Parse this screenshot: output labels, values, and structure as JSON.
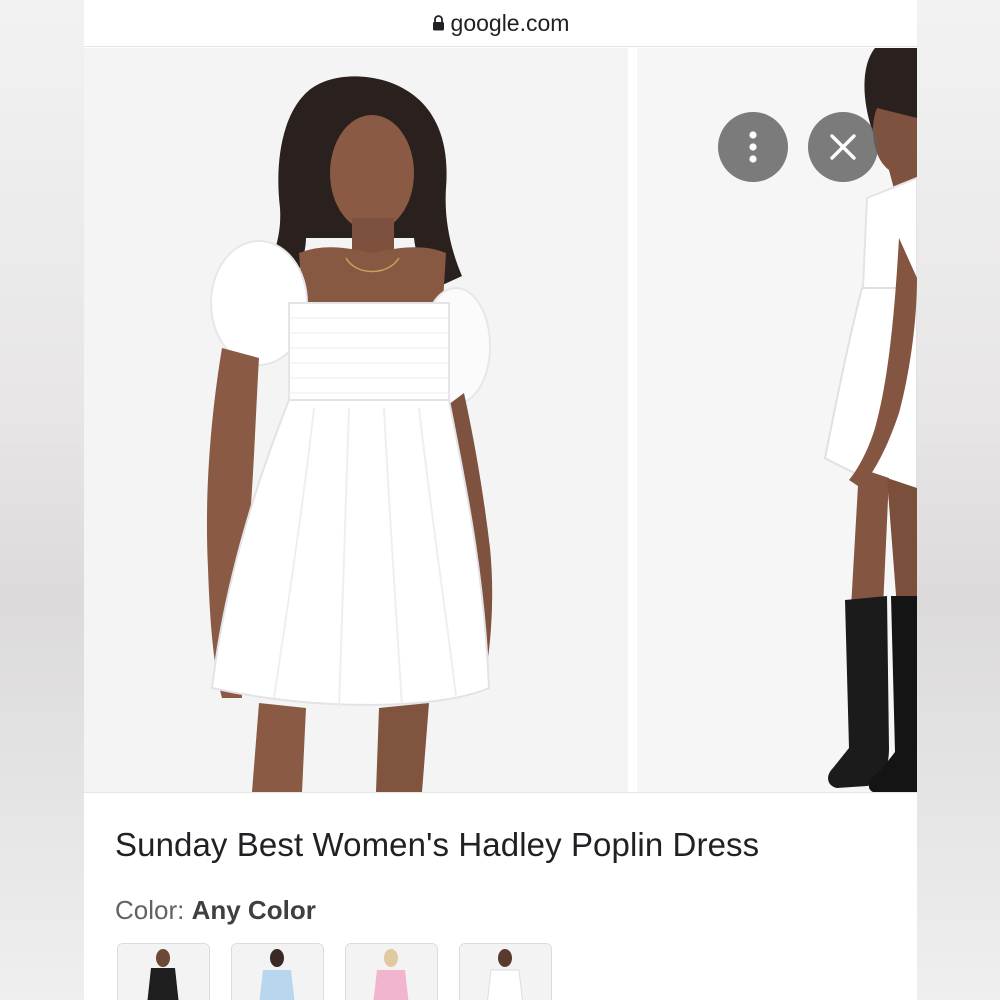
{
  "browser": {
    "url": "google.com"
  },
  "product": {
    "title": "Sunday Best Women's Hadley Poplin Dress",
    "color_label": "Color:",
    "color_value": "Any Color"
  },
  "gallery": {
    "images": [
      {
        "subject": "model in white puff-sleeve mini dress, front view"
      },
      {
        "subject": "model in white mini dress with black knee-high boots, side view"
      }
    ]
  },
  "swatches": [
    {
      "color": "#1e1e1e"
    },
    {
      "color": "#b8d6ee"
    },
    {
      "color": "#f2b5cf"
    },
    {
      "color": "#ffffff"
    }
  ],
  "colors": {
    "text_primary": "#202124",
    "text_secondary": "#5f6368",
    "overlay_button": "#5f5f5f"
  }
}
